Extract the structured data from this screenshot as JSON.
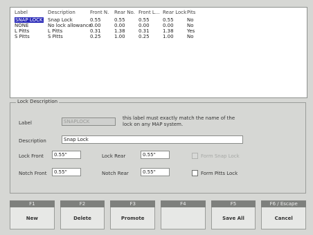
{
  "table": {
    "headers": [
      "Label",
      "Description",
      "Front N.",
      "Rear No.",
      "Front L...",
      "Rear Lock",
      "Pits"
    ],
    "rows": [
      {
        "label": "SNAP LOCK",
        "description": "Snap Lock",
        "front_n": "0.55",
        "rear_n": "0.55",
        "front_l": "0.55",
        "rear_l": "0.55",
        "pits": "No",
        "selected": true
      },
      {
        "label": "NONE",
        "description": "No lock allowance",
        "front_n": "0.00",
        "rear_n": "0.00",
        "front_l": "0.00",
        "rear_l": "0.00",
        "pits": "No",
        "selected": false
      },
      {
        "label": "L Pitts",
        "description": "L Pitts",
        "front_n": "0.31",
        "rear_n": "1.38",
        "front_l": "0.31",
        "rear_l": "1.38",
        "pits": "Yes",
        "selected": false
      },
      {
        "label": "S Pitts",
        "description": "S Pitts",
        "front_n": "0.25",
        "rear_n": "1.00",
        "front_l": "0.25",
        "rear_l": "1.00",
        "pits": "No",
        "selected": false
      }
    ]
  },
  "lock_description": {
    "title": "Lock Description",
    "label_caption": "Label",
    "label_value": "SNAPLOCK",
    "note": "this label must exactly match the name of the lock on any MAP system.",
    "description_caption": "Description",
    "description_value": "Snap Lock",
    "lock_front_caption": "Lock Front",
    "lock_front_value": "0.55\"",
    "lock_rear_caption": "Lock Rear",
    "lock_rear_value": "0.55\"",
    "notch_front_caption": "Notch Front",
    "notch_front_value": "0.55\"",
    "notch_rear_caption": "Notch Rear",
    "notch_rear_value": "0.55\"",
    "form_snap_lock": "Form Snap Lock",
    "form_pitts_lock": "Form Pitts Lock"
  },
  "fkeys": [
    {
      "key": "F1",
      "label": "New"
    },
    {
      "key": "F2",
      "label": "Delete"
    },
    {
      "key": "F3",
      "label": "Promote"
    },
    {
      "key": "F4",
      "label": ""
    },
    {
      "key": "F5",
      "label": "Save All"
    },
    {
      "key": "F6 / Escape",
      "label": "Cancel"
    }
  ]
}
